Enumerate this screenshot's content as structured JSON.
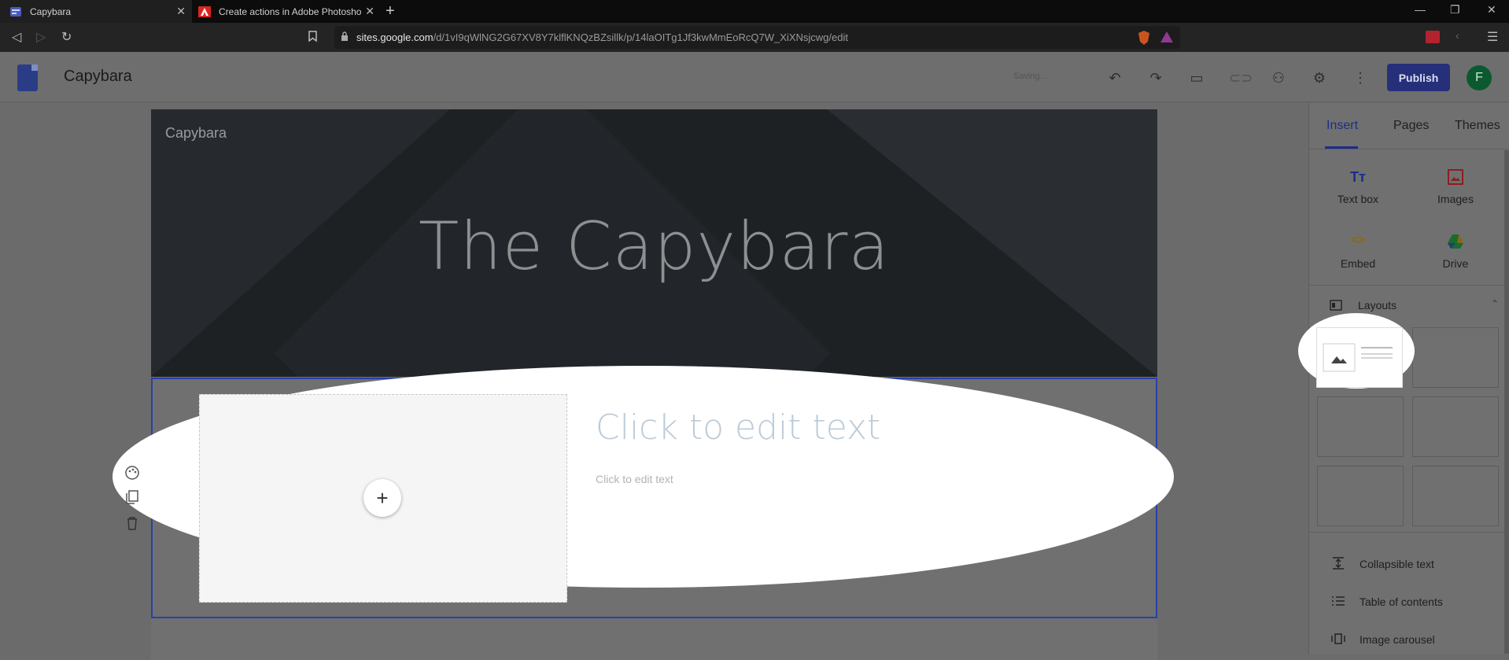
{
  "browser": {
    "tabs": [
      {
        "title": "Capybara"
      },
      {
        "title": "Create actions in Adobe Photosho"
      }
    ],
    "url_host": "sites.google.com",
    "url_path": "/d/1vI9qWlNG2G67XV8Y7klflKNQzBZsillk/p/14laOITg1Jf3kwMmEoRcQ7W_XiXNsjcwg/edit"
  },
  "appbar": {
    "title": "Capybara",
    "status": "Saving...",
    "publish_label": "Publish",
    "avatar_letter": "F"
  },
  "hero": {
    "site_name": "Capybara",
    "title": "The Capybara"
  },
  "section": {
    "heading_placeholder": "Click to edit text",
    "body_placeholder": "Click to edit text"
  },
  "panel": {
    "tabs": [
      "Insert",
      "Pages",
      "Themes"
    ],
    "insert_items": [
      "Text box",
      "Images",
      "Embed",
      "Drive"
    ],
    "layouts_label": "Layouts",
    "list_items": [
      "Collapsible text",
      "Table of contents",
      "Image carousel"
    ]
  },
  "colors": {
    "accent": "#1c2d8a",
    "publish": "#252f7a",
    "selection": "#2741a6"
  }
}
